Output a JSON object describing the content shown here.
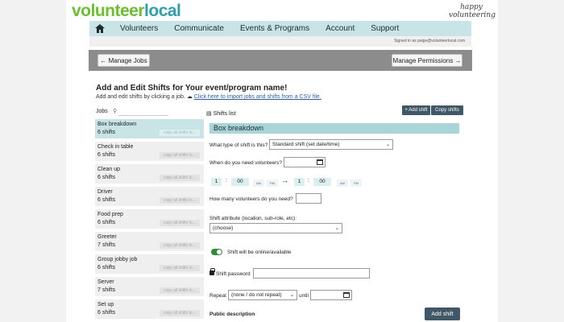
{
  "brand": {
    "logo_v": "volunteer",
    "logo_l": "local",
    "tagline": "happy volunteering"
  },
  "nav": {
    "items": [
      "Volunteers",
      "Communicate",
      "Events & Programs",
      "Account",
      "Support"
    ]
  },
  "signed_in": "Signed in as paige@volunteerlocal.com",
  "toolbar": {
    "manage_jobs": "← Manage Jobs",
    "manage_permissions": "Manage Permissions →"
  },
  "page": {
    "heading": "Add and Edit Shifts for Your event/program name!",
    "sub_prefix": "Add and edit shifts by clicking a job.",
    "import_link": "Click here to import jobs and shifts from a CSV file."
  },
  "jobs": {
    "label": "Jobs",
    "search_placeholder": "",
    "items": [
      {
        "name": "Box breakdown",
        "count": "6 shifts",
        "copy": "copy all shifts to..."
      },
      {
        "name": "Check in table",
        "count": "6 shifts",
        "copy": "copy all shifts to..."
      },
      {
        "name": "Clean up",
        "count": "6 shifts",
        "copy": "copy all shifts to..."
      },
      {
        "name": "Driver",
        "count": "6 shifts",
        "copy": "copy all shifts to..."
      },
      {
        "name": "Food prep",
        "count": "6 shifts",
        "copy": "copy all shifts to..."
      },
      {
        "name": "Greeter",
        "count": "7 shifts",
        "copy": "copy all shifts to..."
      },
      {
        "name": "Group jobby job",
        "count": "6 shifts",
        "copy": "copy all shifts to..."
      },
      {
        "name": "Server",
        "count": "7 shifts",
        "copy": "copy all shifts to..."
      },
      {
        "name": "Set up",
        "count": "6 shifts",
        "copy": "copy all shifts to..."
      }
    ]
  },
  "shifts": {
    "list_label": "Shifts list",
    "add_shift_btn": "+ Add shift",
    "copy_shifts_btn": "Copy shifts",
    "title": "Box breakdown",
    "type_label": "What type of shift is this?",
    "type_value": "Standard shift (set date/time)",
    "when_label": "When do you need volunteers?",
    "start_hour": "1",
    "start_min": "00",
    "end_hour": "1",
    "end_min": "00",
    "am": "AM",
    "pm": "PM",
    "how_many_label": "How many volunteers do you need?",
    "attribute_label": "Shift attribute (location, sub-role, etc):",
    "attribute_value": "(choose)",
    "online_label": "Shift will be online/available",
    "password_label": "Shift password",
    "repeat_label": "Repeat",
    "repeat_value": "(none / do not repeat)",
    "until_label": "until",
    "public_desc_label": "Public description",
    "add_shift_submit": "Add shift"
  },
  "colors": {
    "accent": "#c9e4e6",
    "button_dark": "#3f5766",
    "toggle_on": "#2e8b3a"
  }
}
